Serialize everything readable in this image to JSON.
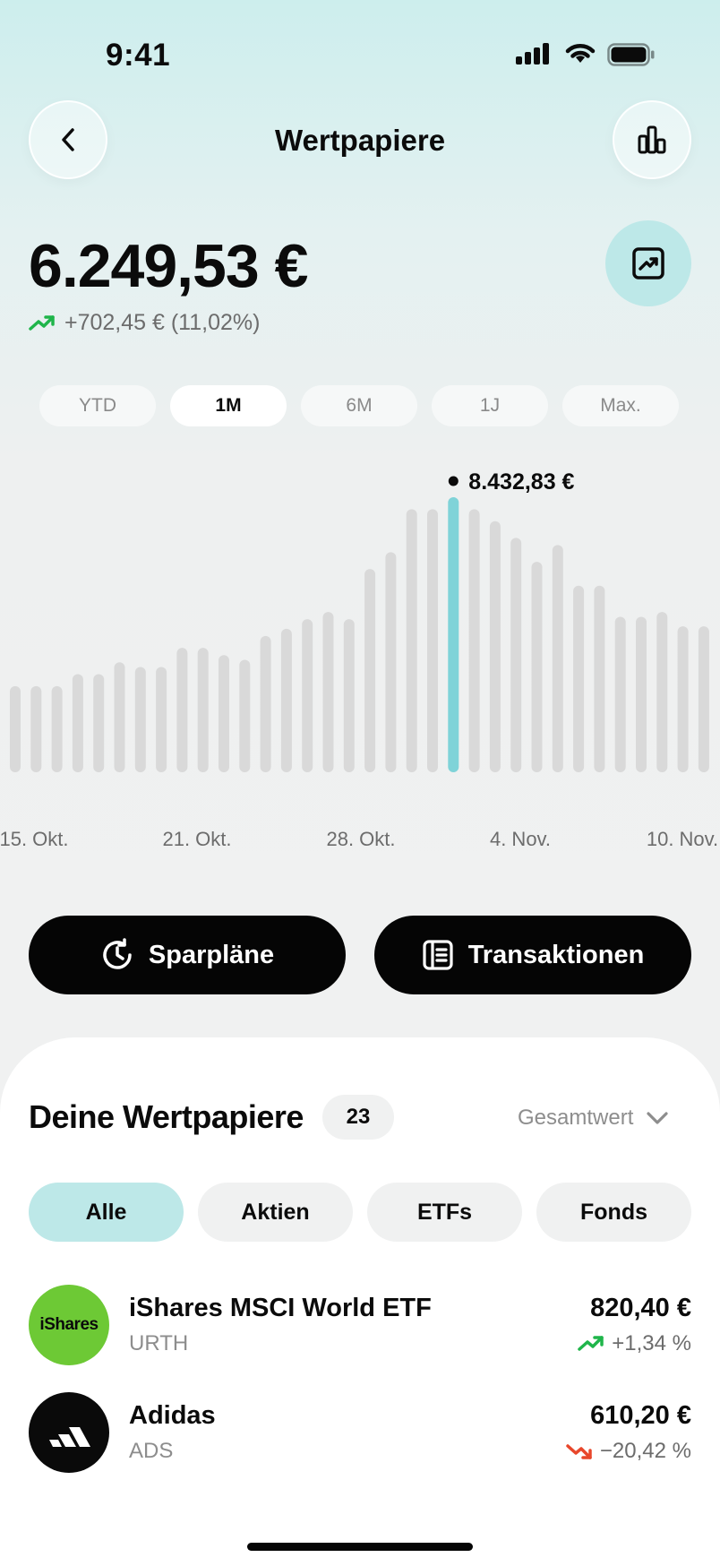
{
  "status_bar": {
    "time": "9:41"
  },
  "header": {
    "title": "Wertpapiere",
    "back_icon": "chevron-left-icon",
    "stats_icon": "bar-chart-icon"
  },
  "portfolio": {
    "balance": "6.249,53 €",
    "change": "+702,45 € (11,02%)",
    "change_direction": "up",
    "trend_icon": "trend-chart-icon"
  },
  "periods": [
    {
      "label": "YTD",
      "active": false
    },
    {
      "label": "1M",
      "active": true
    },
    {
      "label": "6M",
      "active": false
    },
    {
      "label": "1J",
      "active": false
    },
    {
      "label": "Max.",
      "active": false
    }
  ],
  "chart_data": {
    "type": "bar",
    "title": "",
    "xlabel": "",
    "ylabel": "",
    "x_tick_labels": [
      "15. Okt.",
      "21. Okt.",
      "28. Okt.",
      "4. Nov.",
      "10. Nov."
    ],
    "values": [
      1800,
      1800,
      1800,
      2050,
      2050,
      2300,
      2200,
      2200,
      2600,
      2600,
      2450,
      2350,
      2850,
      3000,
      3200,
      3350,
      3200,
      4250,
      4600,
      5500,
      5500,
      5750,
      5500,
      5250,
      4900,
      4400,
      4750,
      3900,
      3900,
      3250,
      3250,
      3350,
      3050,
      3050
    ],
    "highlight_index": 21,
    "highlight_label": "8.432,83 €",
    "colors": {
      "bar": "#d9d9d9",
      "highlight": "#7fd3d8"
    },
    "grid": false,
    "legend": "none"
  },
  "actions": {
    "sparplaene": {
      "label": "Sparpläne",
      "icon": "clock-refresh-icon"
    },
    "transaktionen": {
      "label": "Transaktionen",
      "icon": "receipt-list-icon"
    }
  },
  "holdings": {
    "title": "Deine Wertpapiere",
    "count": "23",
    "sort_label": "Gesamtwert",
    "filters": [
      {
        "label": "Alle",
        "active": true
      },
      {
        "label": "Aktien",
        "active": false
      },
      {
        "label": "ETFs",
        "active": false
      },
      {
        "label": "Fonds",
        "active": false
      }
    ],
    "items": [
      {
        "name": "iShares MSCI World ETF",
        "ticker": "URTH",
        "value": "820,40 €",
        "change": "+1,34 %",
        "direction": "up",
        "logo_text": "iShares",
        "logo_color": "#6dc935"
      },
      {
        "name": "Adidas",
        "ticker": "ADS",
        "value": "610,20 €",
        "change": "−20,42 %",
        "direction": "down",
        "logo_icon": "adidas-logo-icon",
        "logo_color": "#0a0a0a"
      }
    ]
  },
  "theme": {
    "accent": "#bde8e8",
    "up": "#1fb54a",
    "down": "#e8472b",
    "primary": "#050505"
  }
}
